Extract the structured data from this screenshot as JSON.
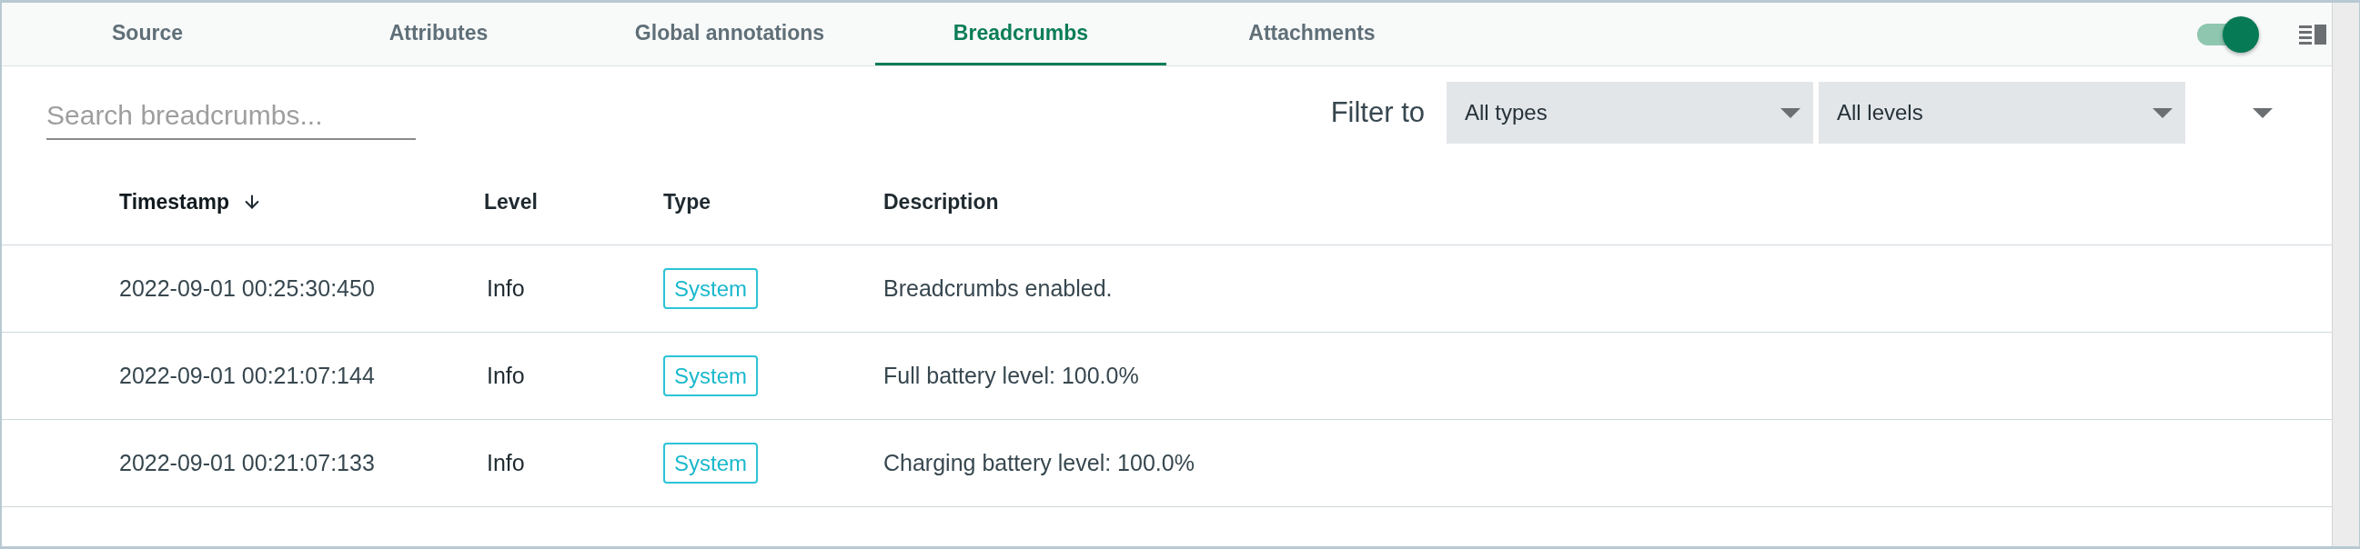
{
  "tabs": [
    {
      "label": "Source",
      "selected": false
    },
    {
      "label": "Attributes",
      "selected": false
    },
    {
      "label": "Global annotations",
      "selected": false
    },
    {
      "label": "Breadcrumbs",
      "selected": true
    },
    {
      "label": "Attachments",
      "selected": false
    }
  ],
  "toolbar": {
    "toggle": {
      "on": true
    }
  },
  "search": {
    "placeholder": "Search breadcrumbs..."
  },
  "filter": {
    "label": "Filter to",
    "selects": [
      {
        "value": "All types"
      },
      {
        "value": "All levels"
      }
    ]
  },
  "table": {
    "columns": [
      {
        "label": "Timestamp",
        "sorted": true,
        "descending": true
      },
      {
        "label": "Level",
        "sorted": false
      },
      {
        "label": "Type",
        "sorted": false
      },
      {
        "label": "Description",
        "sorted": false
      }
    ],
    "rows": [
      {
        "timestamp": "2022-09-01 00:25:30:450",
        "level": "Info",
        "type": "System",
        "description": "Breadcrumbs enabled."
      },
      {
        "timestamp": "2022-09-01 00:21:07:144",
        "level": "Info",
        "type": "System",
        "description": "Full battery level: 100.0%"
      },
      {
        "timestamp": "2022-09-01 00:21:07:133",
        "level": "Info",
        "type": "System",
        "description": "Charging battery level: 100.0%"
      }
    ]
  }
}
